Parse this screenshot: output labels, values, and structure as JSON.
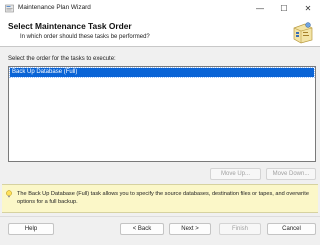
{
  "window": {
    "title": "Maintenance Plan Wizard",
    "minimize_glyph": "—",
    "maximize_glyph": "☐",
    "close_glyph": "✕"
  },
  "header": {
    "title": "Select Maintenance Task Order",
    "subtitle": "In which order should these tasks be performed?"
  },
  "task_section": {
    "prompt": "Select the order for the tasks to execute:",
    "tasks": [
      {
        "label": "Back Up Database (Full)",
        "selected": true
      }
    ],
    "move_up_label": "Move Up...",
    "move_down_label": "Move Down..."
  },
  "info": {
    "text": "The Back Up Database (Full) task allows you to specify the source databases, destination files or tapes, and overwrite options for a full backup."
  },
  "footer": {
    "help_label": "Help",
    "back_label": "< Back",
    "next_label": "Next >",
    "finish_label": "Finish",
    "cancel_label": "Cancel"
  },
  "colors": {
    "selection": "#0a64d6",
    "info_background": "#fbf7c8",
    "dialog_background": "#f0f0f0"
  },
  "icons": {
    "app": "wizard-icon",
    "header": "maintenance-plan-icon",
    "info": "lightbulb-icon"
  }
}
